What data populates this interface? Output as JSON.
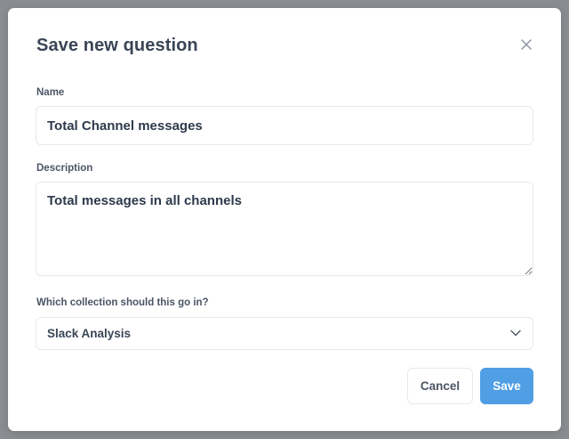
{
  "modal": {
    "title": "Save new question",
    "name_label": "Name",
    "name_value": "Total Channel messages",
    "description_label": "Description",
    "description_value": "Total messages in all channels",
    "collection_label": "Which collection should this go in?",
    "collection_value": "Slack Analysis",
    "cancel_label": "Cancel",
    "save_label": "Save"
  },
  "icons": {
    "close": "close-icon",
    "dropdown": "chevron-down-icon"
  },
  "colors": {
    "primary": "#509ee3",
    "text": "#2e3a4c",
    "border": "#e6e9ee",
    "overlay": "#8a8d91"
  }
}
